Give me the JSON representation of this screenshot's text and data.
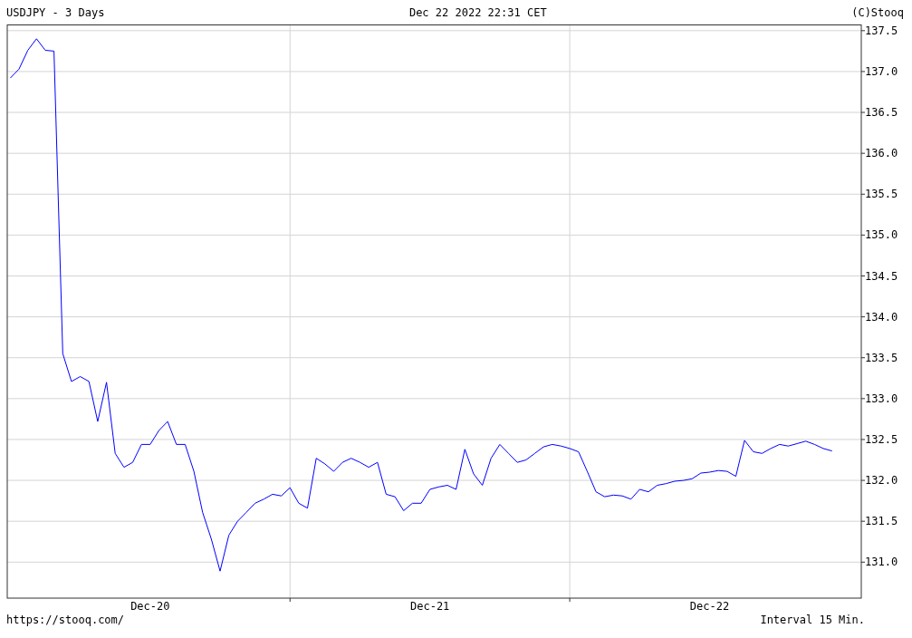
{
  "header": {
    "title": "USDJPY - 3 Days",
    "timestamp": "Dec 22 2022 22:31 CET",
    "copyright": "(C)Stooq"
  },
  "chart": {
    "chart_data": {
      "type": "line",
      "grid": true,
      "ylim": [
        130.56,
        137.57
      ],
      "yticks": [
        {
          "value": 131,
          "label": "131.0"
        },
        {
          "value": 131.5,
          "label": "131.5"
        },
        {
          "value": 132,
          "label": "132.0"
        },
        {
          "value": 132.5,
          "label": "132.5"
        },
        {
          "value": 133,
          "label": "133.0"
        },
        {
          "value": 133.5,
          "label": "133.5"
        },
        {
          "value": 134,
          "label": "134.0"
        },
        {
          "value": 134.5,
          "label": "134.5"
        },
        {
          "value": 135,
          "label": "135.0"
        },
        {
          "value": 135.5,
          "label": "135.5"
        },
        {
          "value": 136,
          "label": "136.0"
        },
        {
          "value": 136.5,
          "label": "136.5"
        },
        {
          "value": 137,
          "label": "137.0"
        },
        {
          "value": 137.5,
          "label": "137.5"
        }
      ],
      "categories": [
        null,
        null,
        null,
        null,
        null,
        null,
        null,
        null,
        null,
        null,
        null,
        null,
        null,
        null,
        null,
        null,
        "Dec-20",
        null,
        null,
        null,
        null,
        null,
        null,
        null,
        null,
        null,
        null,
        null,
        null,
        null,
        null,
        null,
        null,
        null,
        null,
        null,
        null,
        null,
        null,
        null,
        null,
        null,
        null,
        null,
        null,
        null,
        null,
        null,
        "Dec-21",
        null,
        null,
        null,
        null,
        null,
        null,
        null,
        null,
        null,
        null,
        null,
        null,
        null,
        null,
        null,
        null,
        null,
        null,
        null,
        null,
        null,
        null,
        null,
        null,
        null,
        null,
        null,
        null,
        null,
        null,
        null,
        "Dec-22",
        null,
        null,
        null,
        null,
        null,
        null,
        null,
        null,
        null,
        null,
        null,
        null,
        null,
        null
      ],
      "series": [
        {
          "color": "#0000ff",
          "values": [
            136.92,
            137.03,
            137.26,
            137.4,
            137.26,
            137.25,
            133.55,
            133.21,
            133.27,
            133.21,
            132.72,
            133.2,
            132.33,
            132.16,
            132.22,
            132.44,
            132.44,
            132.61,
            132.72,
            132.44,
            132.44,
            132.11,
            131.61,
            131.28,
            130.89,
            131.33,
            131.5,
            131.61,
            131.72,
            131.77,
            131.83,
            131.81,
            131.91,
            131.72,
            131.66,
            132.27,
            132.2,
            132.11,
            132.22,
            132.27,
            132.22,
            132.16,
            132.22,
            131.83,
            131.8,
            131.63,
            131.72,
            131.72,
            131.89,
            131.92,
            131.94,
            131.89,
            132.38,
            132.08,
            131.94,
            132.27,
            132.44,
            132.33,
            132.22,
            132.25,
            132.33,
            132.41,
            132.44,
            132.42,
            132.39,
            132.35,
            132.11,
            131.86,
            131.8,
            131.82,
            131.81,
            131.77,
            131.89,
            131.86,
            131.94,
            131.96,
            131.99,
            132.0,
            132.02,
            132.09,
            132.1,
            132.12,
            132.11,
            132.05,
            132.49,
            132.35,
            132.33,
            132.39,
            132.44,
            132.42,
            132.45,
            132.48,
            132.44,
            132.39,
            132.36
          ]
        }
      ]
    }
  },
  "footer": {
    "url": "https://stooq.com/",
    "interval": "Interval 15 Min."
  }
}
